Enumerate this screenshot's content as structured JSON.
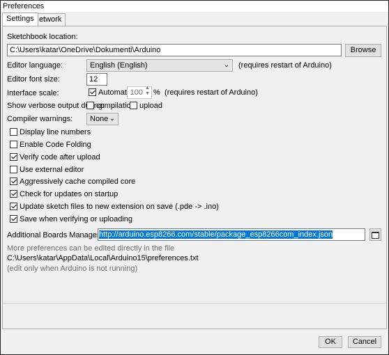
{
  "window": {
    "title": "Preferences"
  },
  "tabs": [
    {
      "label": "Settings",
      "active": true
    },
    {
      "label": "Network",
      "active": false
    }
  ],
  "sketchbook": {
    "label": "Sketchbook location:",
    "value": "C:\\Users\\katar\\OneDrive\\Dokumenti\\Arduino",
    "browse_label": "Browse"
  },
  "editor_language": {
    "label": "Editor language:",
    "value": "English (English)",
    "note": "(requires restart of Arduino)"
  },
  "editor_font_size": {
    "label": "Editor font size:",
    "value": "12"
  },
  "interface_scale": {
    "label": "Interface scale:",
    "automatic_label": "Automatic",
    "automatic_checked": true,
    "value": "100",
    "percent": "%",
    "note": "(requires restart of Arduino)"
  },
  "verbose": {
    "label": "Show verbose output during:",
    "compilation_label": "compilation",
    "compilation_checked": false,
    "upload_label": "upload",
    "upload_checked": false
  },
  "compiler_warnings": {
    "label": "Compiler warnings:",
    "value": "None"
  },
  "options": [
    {
      "label": "Display line numbers",
      "checked": false
    },
    {
      "label": "Enable Code Folding",
      "checked": false
    },
    {
      "label": "Verify code after upload",
      "checked": true
    },
    {
      "label": "Use external editor",
      "checked": false
    },
    {
      "label": "Aggressively cache compiled core",
      "checked": true
    },
    {
      "label": "Check for updates on startup",
      "checked": true
    },
    {
      "label": "Update sketch files to new extension on save (.pde -> .ino)",
      "checked": true
    },
    {
      "label": "Save when verifying or uploading",
      "checked": true
    }
  ],
  "boards_manager": {
    "label": "Additional Boards Manager URLs:",
    "value": "http://arduino.esp8266.com/stable/package_esp8266com_index.json"
  },
  "footer_info": {
    "line1": "More preferences can be edited directly in the file",
    "line2": "C:\\Users\\katar\\AppData\\Local\\Arduino15\\preferences.txt",
    "line3": "(edit only when Arduino is not running)"
  },
  "buttons": {
    "ok": "OK",
    "cancel": "Cancel"
  },
  "icons": {
    "dropdown": "chevron-down-icon",
    "spinner": "spinner-arrows-icon",
    "boards_editor": "window-icon"
  }
}
